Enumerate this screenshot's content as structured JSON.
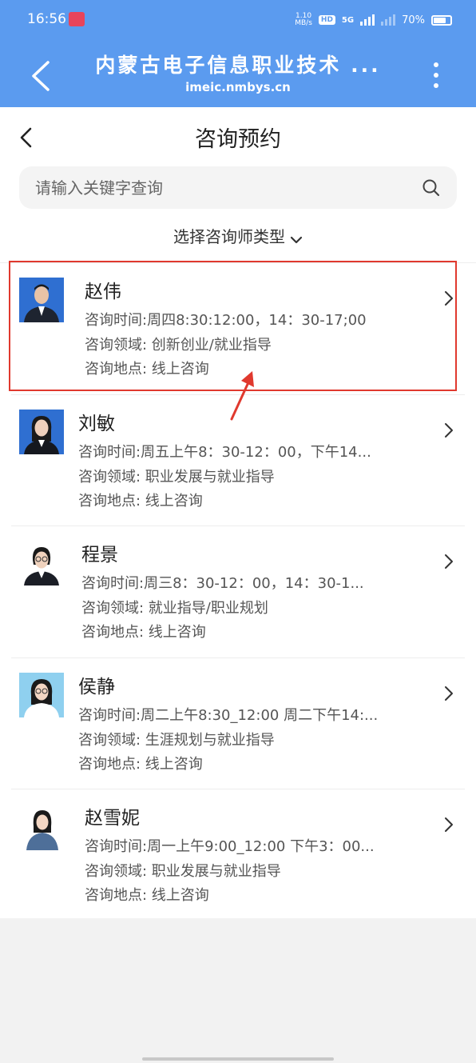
{
  "status_bar": {
    "time": "16:56",
    "net_speed": "1.10\nMB/s",
    "hd": "HD",
    "network": "5G",
    "battery": "70%"
  },
  "browser": {
    "title": "内蒙古电子信息职业技术 ...",
    "url": "imeic.nmbys.cn"
  },
  "page": {
    "title": "咨询预约"
  },
  "search": {
    "placeholder": "请输入关键字查询"
  },
  "filter": {
    "label": "选择咨询师类型"
  },
  "counselors": [
    {
      "name": "赵伟",
      "time": "咨询时间:周四8:30:12:00，14：30-17;00",
      "field": "咨询领域: 创新创业/就业指导",
      "place": "咨询地点: 线上咨询"
    },
    {
      "name": "刘敏",
      "time": "咨询时间:周五上午8：30-12：00，下午14...",
      "field": "咨询领域: 职业发展与就业指导",
      "place": "咨询地点: 线上咨询"
    },
    {
      "name": "程景",
      "time": "咨询时间:周三8：30-12：00，14：30-1...",
      "field": "咨询领域: 就业指导/职业规划",
      "place": "咨询地点: 线上咨询"
    },
    {
      "name": "侯静",
      "time": "咨询时间:周二上午8:30_12:00 周二下午14:...",
      "field": "咨询领域: 生涯规划与就业指导",
      "place": "咨询地点: 线上咨询"
    },
    {
      "name": "赵雪妮",
      "time": "咨询时间:周一上午9:00_12:00 下午3：00...",
      "field": "咨询领域: 职业发展与就业指导",
      "place": "咨询地点: 线上咨询"
    }
  ],
  "colors": {
    "header_bg": "#5b9bef",
    "highlight": "#e0392e"
  }
}
